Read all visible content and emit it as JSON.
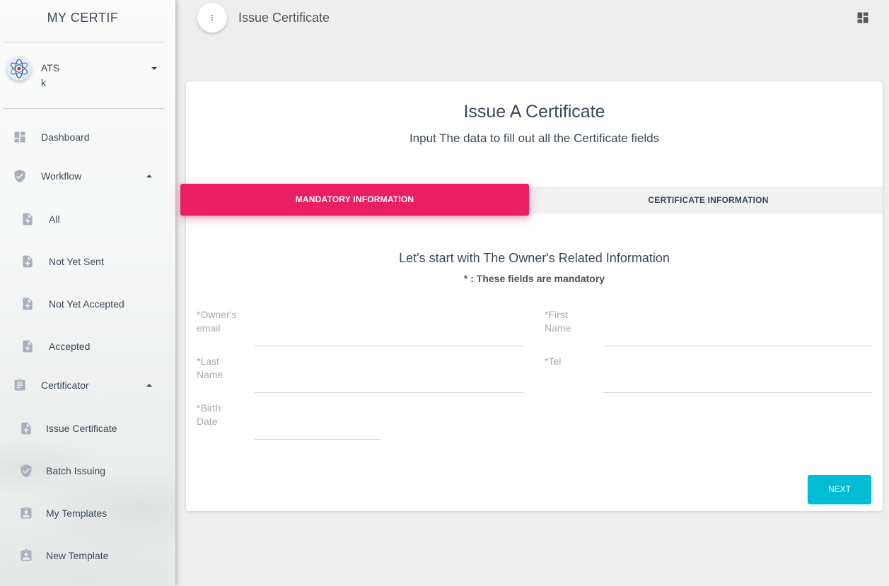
{
  "sidebar": {
    "brand": "MY CERTIF",
    "user": {
      "name": "ATS",
      "sub": "k"
    },
    "items": [
      {
        "label": "Dashboard",
        "icon": "dashboard-icon"
      },
      {
        "label": "Workflow",
        "icon": "verified-shield-icon",
        "expanded": true
      },
      {
        "label": "All",
        "icon": "note-add-icon"
      },
      {
        "label": "Not Yet Sent",
        "icon": "note-add-icon"
      },
      {
        "label": "Not Yet Accepted",
        "icon": "note-add-icon"
      },
      {
        "label": "Accepted",
        "icon": "note-add-icon"
      },
      {
        "label": "Certificator",
        "icon": "assignment-icon",
        "expanded": true
      },
      {
        "label": "Issue Certificate",
        "icon": "note-add-icon"
      },
      {
        "label": "Batch Issuing",
        "icon": "verified-shield-icon"
      },
      {
        "label": "My Templates",
        "icon": "assignment-ind-icon"
      },
      {
        "label": "New Template",
        "icon": "assignment-ind-icon"
      }
    ]
  },
  "topbar": {
    "title": "Issue Certificate",
    "menu_icon": "more-vert-icon",
    "right_icon": "dashboard-icon"
  },
  "card": {
    "title": "Issue A Certificate",
    "subtitle": "Input The data to fill out all the Certificate fields",
    "tabs": [
      {
        "label": "MANDATORY INFORMATION",
        "active": true
      },
      {
        "label": "CERTIFICATE INFORMATION",
        "active": false
      }
    ],
    "section_title": "Let's start with The Owner's Related Information",
    "section_note": "* : These fields are mandatory",
    "fields": {
      "owner_email": {
        "label_line1": "*Owner's",
        "label_line2": "email",
        "value": ""
      },
      "first_name": {
        "label_line1": "*First",
        "label_line2": "Name",
        "value": ""
      },
      "last_name": {
        "label_line1": "*Last",
        "label_line2": "Name",
        "value": ""
      },
      "tel": {
        "label_line1": "*Tel",
        "label_line2": "",
        "value": ""
      },
      "birth_date": {
        "label_line1": "*Birth",
        "label_line2": "Date",
        "value": ""
      }
    },
    "next_label": "NEXT"
  },
  "colors": {
    "accent": "#e91e63",
    "info": "#00bcd4",
    "text": "#3c4858",
    "icon": "#a9afbb"
  }
}
